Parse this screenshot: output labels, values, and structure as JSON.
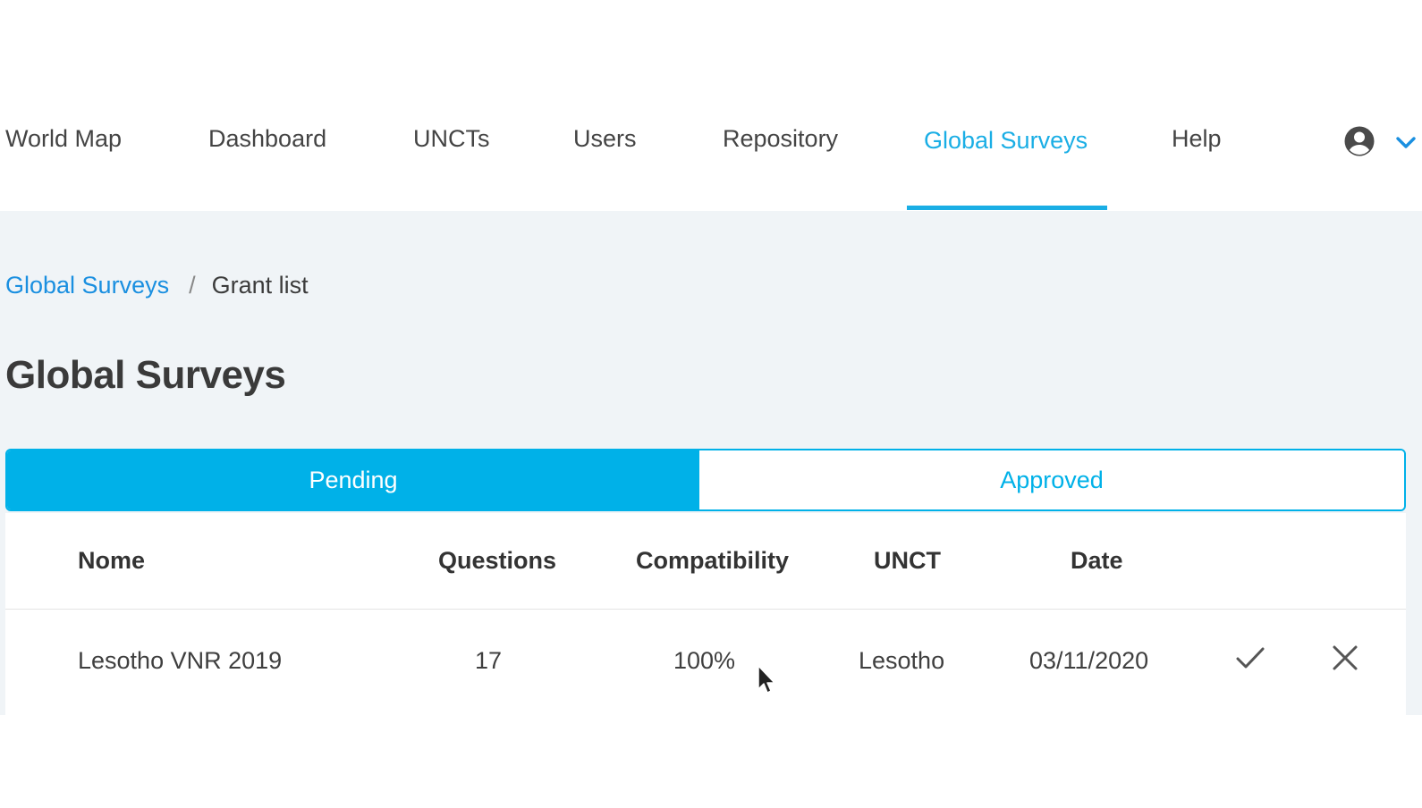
{
  "nav": {
    "items": [
      {
        "label": "World Map",
        "active": false
      },
      {
        "label": "Dashboard",
        "active": false
      },
      {
        "label": "UNCTs",
        "active": false
      },
      {
        "label": "Users",
        "active": false
      },
      {
        "label": "Repository",
        "active": false
      },
      {
        "label": "Global Surveys",
        "active": true
      },
      {
        "label": "Help",
        "active": false
      }
    ],
    "user_icon": "account-circle-icon",
    "menu_icon": "chevron-down-icon"
  },
  "breadcrumb": {
    "parent": "Global Surveys",
    "separator": "/",
    "current": "Grant list"
  },
  "page": {
    "title": "Global Surveys"
  },
  "tabs": [
    {
      "label": "Pending",
      "selected": true
    },
    {
      "label": "Approved",
      "selected": false
    }
  ],
  "table": {
    "columns": [
      "Nome",
      "Questions",
      "Compatibility",
      "UNCT",
      "Date"
    ],
    "rows": [
      {
        "name": "Lesotho VNR 2019",
        "questions": "17",
        "compatibility": "100%",
        "unct": "Lesotho",
        "date": "03/11/2020",
        "approve_icon": "check-icon",
        "reject_icon": "close-icon"
      }
    ]
  },
  "colors": {
    "accent": "#00b1e8",
    "link": "#1a8fe0",
    "content_background": "#f0f4f7"
  }
}
